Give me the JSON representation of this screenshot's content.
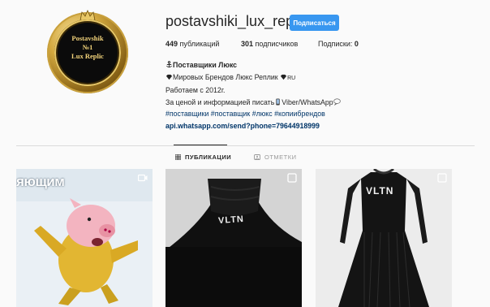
{
  "profile": {
    "username": "postavshiki_lux_replic",
    "subscribe_label": "Подписаться",
    "avatar_text": [
      "Postavshik",
      "№1",
      "Lux Replic"
    ]
  },
  "stats": {
    "posts": {
      "value": "449",
      "label": "публикаций"
    },
    "followers": {
      "value": "301",
      "label": "подписчиков"
    },
    "following": {
      "label": "Подписки:",
      "value": "0"
    }
  },
  "bio": {
    "name": "Поставщики Люкс",
    "line1": "Мировых Брендов Люкс Реплик",
    "line1_suffix": "RU",
    "line2": "Работаем с 2012г.",
    "line3": "За ценой и информацией писать",
    "line3_suffix": "Viber/WhatsApp",
    "hashtags": "#поставщики #поставщик #люкс #копиибрендов",
    "link": "api.whatsapp.com/send?phone=79644918999"
  },
  "tabs": [
    {
      "label": "ПУБЛИКАЦИИ",
      "icon": "grid-icon",
      "active": true
    },
    {
      "label": "ОТМЕТКИ",
      "icon": "tag-icon",
      "active": false
    }
  ],
  "posts": [
    {
      "overlay_text": "яющим",
      "badge": "video-icon"
    },
    {
      "overlay_text": "VLTN",
      "badge": "multi-post-icon"
    },
    {
      "overlay_text": "VLTN",
      "badge": "multi-post-icon"
    }
  ],
  "colors": {
    "accent": "#3897f0",
    "link": "#003569",
    "background": "#fafafa",
    "divider": "#dbdbdb"
  }
}
